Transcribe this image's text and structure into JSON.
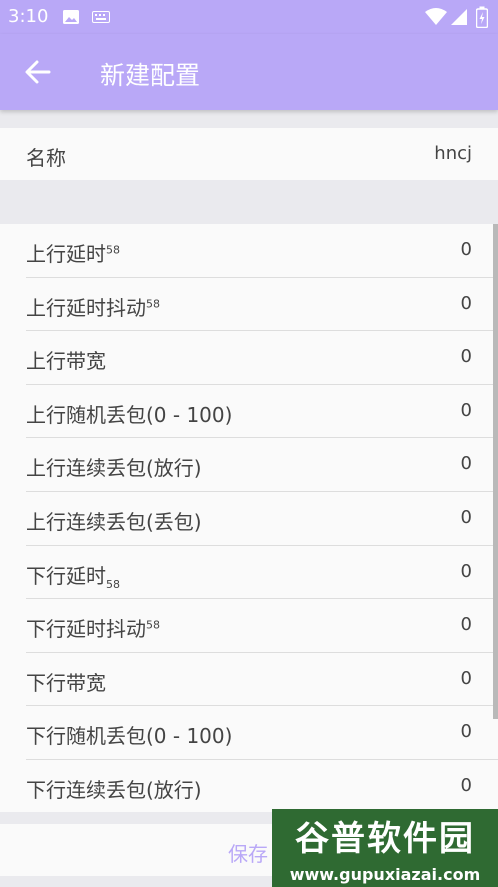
{
  "status_bar": {
    "time": "3:10"
  },
  "appbar": {
    "title": "新建配置"
  },
  "name_row": {
    "label": "名称",
    "value": "hncj"
  },
  "rows": [
    {
      "label": "上行延时",
      "mark": "58",
      "value": "0"
    },
    {
      "label": "上行延时抖动",
      "mark": "58",
      "value": "0"
    },
    {
      "label": "上行带宽",
      "value": "0"
    },
    {
      "label": "上行随机丢包(0 - 100)",
      "value": "0"
    },
    {
      "label": "上行连续丢包(放行)",
      "value": "0"
    },
    {
      "label": "上行连续丢包(丢包)",
      "value": "0"
    },
    {
      "label": "下行延时",
      "mark": "58",
      "value": "0"
    },
    {
      "label": "下行延时抖动",
      "mark": "58",
      "value": "0"
    },
    {
      "label": "下行带宽",
      "value": "0"
    },
    {
      "label": "下行随机丢包(0 - 100)",
      "value": "0"
    },
    {
      "label": "下行连续丢包(放行)",
      "value": "0"
    }
  ],
  "save_label": "保存",
  "watermark": {
    "title": "谷普软件园",
    "url": "www.gupuxiazai.com"
  },
  "colors": {
    "accent": "#b9a8f7",
    "watermark_bg": "#2f6a32"
  },
  "icons": [
    "image-icon",
    "keyboard-icon",
    "wifi-icon",
    "signal-icon",
    "battery-icon",
    "back-arrow-icon"
  ]
}
